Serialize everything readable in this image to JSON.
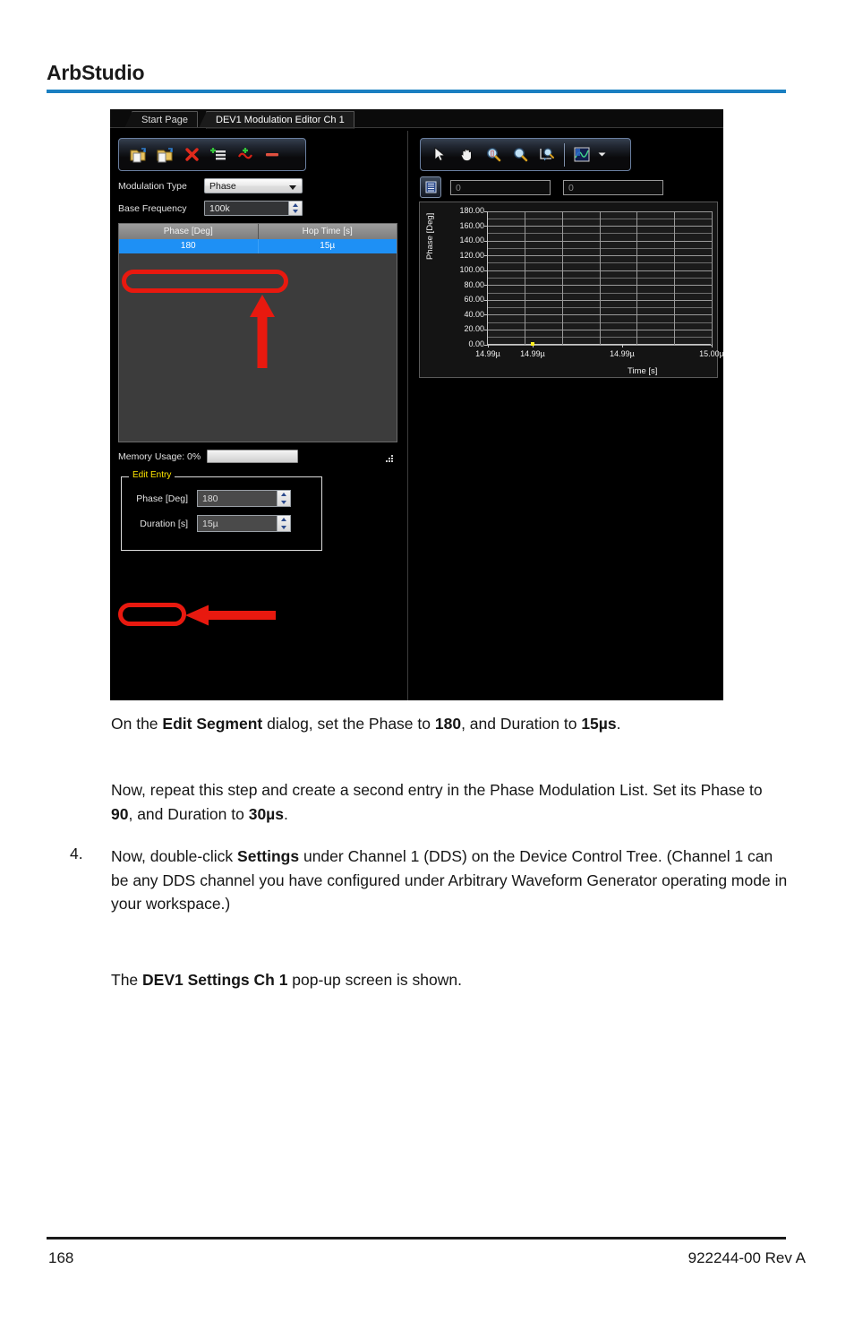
{
  "document": {
    "title": "ArbStudio",
    "footer_page": "168",
    "footer_doc": "922244-00 Rev A"
  },
  "app": {
    "tabs": [
      {
        "label": "Start Page",
        "active": false
      },
      {
        "label": "DEV1 Modulation Editor Ch 1",
        "active": true
      }
    ],
    "modulation_toolbar": [
      {
        "name": "open-file-icon",
        "title": "Open"
      },
      {
        "name": "save-file-icon",
        "title": "Save"
      },
      {
        "name": "delete-icon",
        "title": "Delete"
      },
      {
        "name": "add-list-entry-icon",
        "title": "Add Entry"
      },
      {
        "name": "add-waveform-icon",
        "title": "Add Waveform"
      },
      {
        "name": "remove-icon",
        "title": "Remove"
      }
    ],
    "graph_toolbar": [
      {
        "name": "pointer-icon",
        "title": "Select"
      },
      {
        "name": "pan-hand-icon",
        "title": "Pan"
      },
      {
        "name": "zoom-box-icon",
        "title": "Zoom Region"
      },
      {
        "name": "zoom-icon",
        "title": "Zoom"
      },
      {
        "name": "axis-fit-icon",
        "title": "Fit Axes"
      },
      {
        "name": "graph-style-icon",
        "title": "Graph Style"
      },
      {
        "name": "chevron-down-icon",
        "title": "More"
      }
    ],
    "settings": {
      "modulation_type_label": "Modulation Type",
      "modulation_type_value": "Phase",
      "base_frequency_label": "Base Frequency",
      "base_frequency_value": "100k"
    },
    "list": {
      "columns": [
        "Phase [Deg]",
        "Hop Time [s]"
      ],
      "rows": [
        {
          "phase": "180",
          "hop_time": "15µ",
          "selected": true
        }
      ]
    },
    "memory": {
      "label": "Memory Usage: 0%",
      "percent": 0
    },
    "edit_entry": {
      "title": "Edit Entry",
      "fields": [
        {
          "label": "Phase [Deg]",
          "value": "180"
        },
        {
          "label": "Duration [s]",
          "value": "15µ"
        }
      ]
    },
    "readouts": {
      "cursor_icon": "cursor-readout-icon",
      "x_value": "0",
      "y_value": "0"
    }
  },
  "chart_data": {
    "type": "scatter",
    "title": "",
    "xlabel": "Time [s]",
    "ylabel": "Phase [Deg]",
    "ylim": [
      0,
      180
    ],
    "y_ticks": [
      "0.00",
      "20.00",
      "40.00",
      "60.00",
      "80.00",
      "100.00",
      "120.00",
      "140.00",
      "160.00",
      "180.00"
    ],
    "y_tick_values": [
      0,
      20,
      40,
      60,
      80,
      100,
      120,
      140,
      160,
      180
    ],
    "y_minor_step": 10,
    "x_ticks": [
      "14.99µ",
      "14.99µ",
      "14.99µ",
      "15.00µ"
    ],
    "x_tick_positions": [
      0,
      0.2,
      0.6,
      1.0
    ],
    "x_gridlines": 6,
    "grid": true,
    "legend": "none",
    "points": [
      {
        "x": 0.2,
        "y": 0,
        "color": "#ffef20"
      }
    ]
  },
  "annotations": {
    "ring_list_row": "callout-ring",
    "ring_edit_entry": "callout-ring",
    "arrow_up": "callout-arrow-up",
    "arrow_left": "callout-arrow-left",
    "color": "#e8190f"
  },
  "body": {
    "p1": {
      "a": "On the ",
      "b1": "Edit Segment",
      "c": " dialog, set the Phase to ",
      "b2": "180",
      "d": ", and Duration to ",
      "b3": "15µs",
      "e": "."
    },
    "p2": {
      "a": "Now, repeat this step and create a second entry in the Phase Modulation List. Set its Phase to ",
      "b1": "90",
      "c": ", and Duration to ",
      "b2": "30µs",
      "d": "."
    },
    "step_number": "4.",
    "p3": {
      "a": "Now, double-click ",
      "b1": "Settings",
      "c": " under Channel 1 (DDS) on the Device Control Tree. (Channel 1 can be any DDS channel you have configured under Arbitrary Waveform Generator operating mode in your workspace.)"
    },
    "p4": {
      "a": "The ",
      "b1": "DEV1 Settings Ch 1",
      "c": " pop-up screen is shown."
    }
  }
}
